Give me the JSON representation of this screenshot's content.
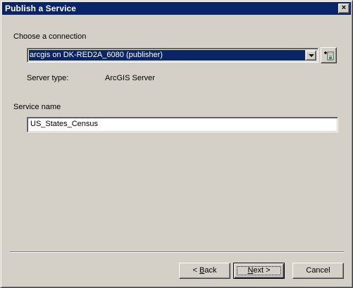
{
  "window": {
    "title": "Publish a Service",
    "close_glyph": "×"
  },
  "connection": {
    "label": "Choose a connection",
    "selected": "arcgis on DK-RED2A_6080 (publisher)",
    "add_connection_icon": "add-server-connection-icon"
  },
  "server_type": {
    "label": "Server type:",
    "value": "ArcGIS Server"
  },
  "service_name": {
    "label": "Service name",
    "value": "US_States_Census"
  },
  "buttons": {
    "back": {
      "accel": "B",
      "rest": "ack",
      "prefix": "< "
    },
    "next": {
      "accel": "N",
      "rest": "ext >"
    },
    "cancel": "Cancel"
  }
}
